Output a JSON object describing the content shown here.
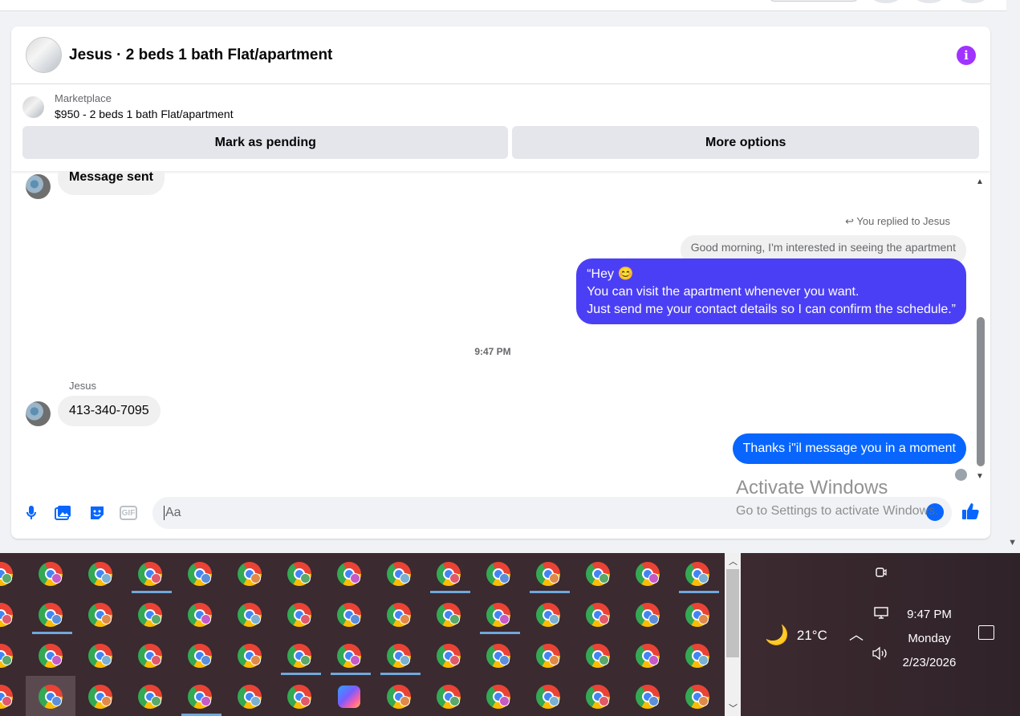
{
  "conversation": {
    "title": "Jesus · 2 beds 1 bath Flat/apartment",
    "info_icon": "info-icon",
    "marketplace_label": "Marketplace",
    "listing": "$950 - 2 beds 1 bath Flat/apartment",
    "mark_pending": "Mark as pending",
    "more_options": "More options"
  },
  "messages": {
    "sent_status": "Message sent",
    "replied_label": "You replied to Jesus",
    "quoted_text": "Good morning, I'm interested in seeing the apartment",
    "reply_line1": "“Hey 😊",
    "reply_line2": "You can visit the apartment whenever you want.",
    "reply_line3": "Just send me your contact details so I can confirm the schedule.”",
    "timestamp": "9:47 PM",
    "sender_name": "Jesus",
    "phone_message": "413-340-7095",
    "last_message": "Thanks i\"il message you in a moment"
  },
  "composer": {
    "placeholder": "Aa",
    "icons": [
      "microphone-icon",
      "image-icon",
      "sticker-icon",
      "gif-icon",
      "emoji-icon",
      "thumbs-up-icon"
    ],
    "gif_label": "GIF"
  },
  "watermark": {
    "line1": "Activate Windows",
    "line2": "Go to Settings to activate Windows."
  },
  "taskbar": {
    "temperature": "21°C",
    "time": "9:47 PM",
    "day": "Monday",
    "date": "2/23/2026",
    "profile_colors": [
      "#e05a6a",
      "#5b8fd9",
      "#e08a4a",
      "#5aa86a",
      "#c65ac6",
      "#7ab0d0"
    ]
  },
  "colors": {
    "outgoing_bubble": "#4b3ff5",
    "outgoing_bubble_latest": "#0866ff",
    "incoming_bubble": "#f0f0f0",
    "info_icon": "#a033ff"
  }
}
